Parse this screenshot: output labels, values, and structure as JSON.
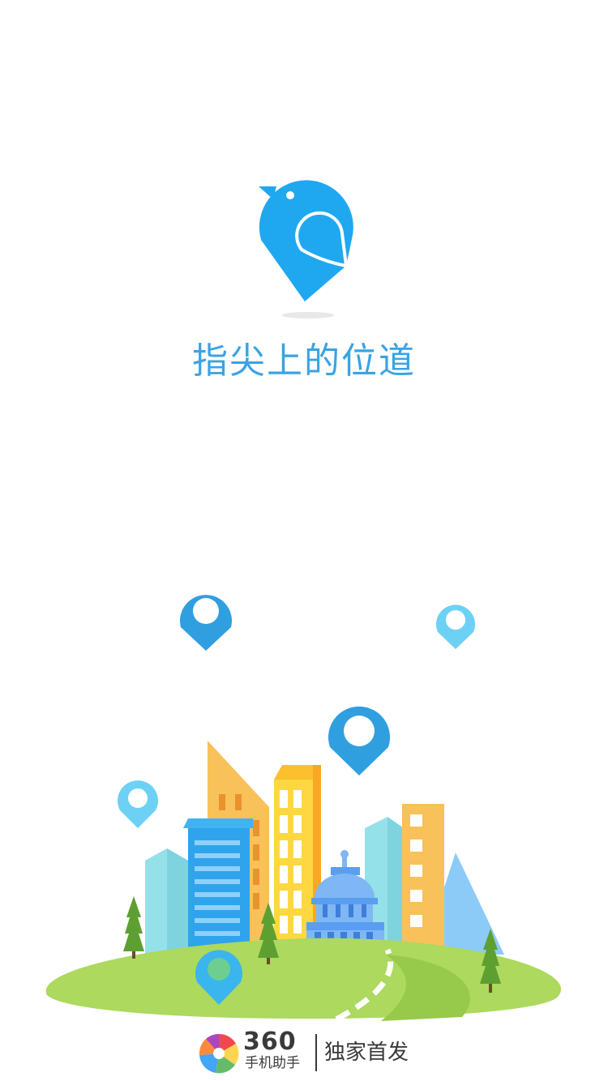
{
  "splash": {
    "slogan": "指尖上的位道",
    "logo_icon": "bird-location-pin-icon",
    "illustration": "city-with-location-pins"
  },
  "footer": {
    "brand_number": "360",
    "brand_name": "手机助手",
    "tagline": "独家首发",
    "logo_icon": "360-assistant-logo-icon"
  },
  "colors": {
    "brand_blue": "#1fa8f0",
    "slogan_blue": "#3aa3e3",
    "grass": "#acd95e",
    "footer_text": "#3a3a3a"
  }
}
